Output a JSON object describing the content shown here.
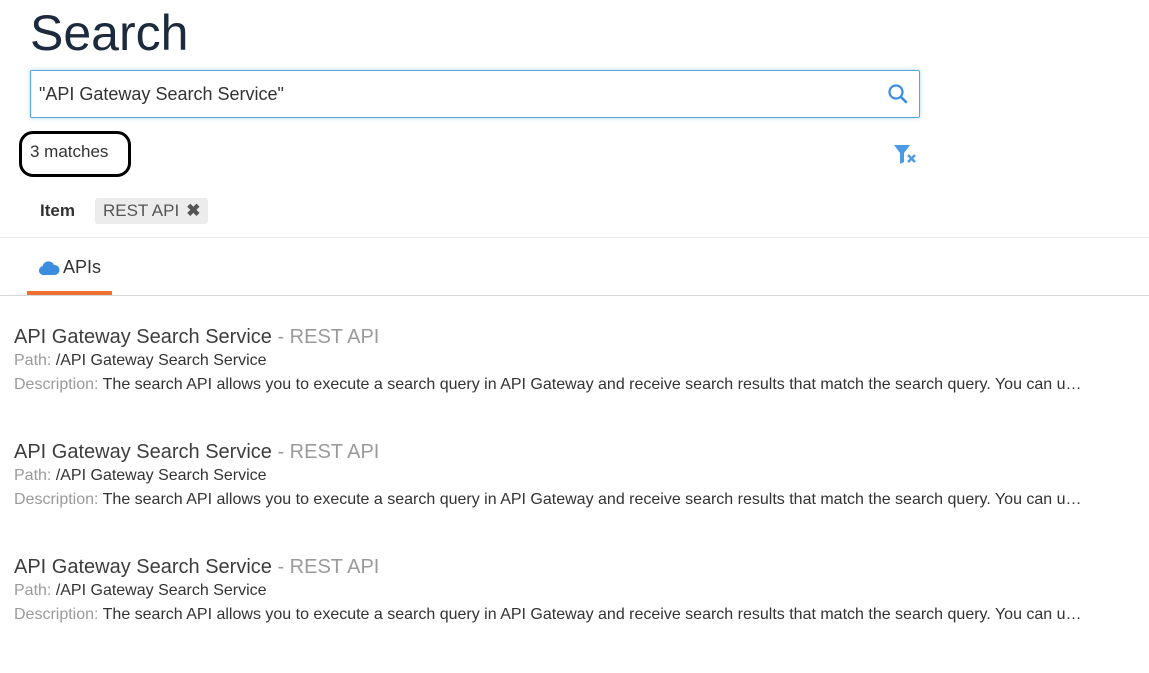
{
  "header": {
    "title": "Search"
  },
  "search": {
    "value": "\"API Gateway Search Service\"",
    "placeholder": ""
  },
  "summary": {
    "match_count": "3 matches"
  },
  "filters": {
    "facet_label": "Item",
    "chips": [
      {
        "label": "REST API",
        "remove_glyph": "✖"
      }
    ]
  },
  "tabs": [
    {
      "label": "APIs",
      "icon": "cloud-icon",
      "active": true
    }
  ],
  "colors": {
    "accent": "#f0712d",
    "link_icon": "#3b8de0",
    "title": "#1b2a3c",
    "annotation": "#000000"
  },
  "results": [
    {
      "name": "API Gateway Search Service",
      "type": "- REST API",
      "path_label": "Path:",
      "path": "/API Gateway Search Service",
      "description_label": "Description:",
      "description": "The search API allows you to execute a search query in API Gateway and receive search results that match the search query. You can use this service to search for APIs, applications, aliases, policies and other API Gateway assets."
    },
    {
      "name": "API Gateway Search Service",
      "type": "- REST API",
      "path_label": "Path:",
      "path": "/API Gateway Search Service",
      "description_label": "Description:",
      "description": "The search API allows you to execute a search query in API Gateway and receive search results that match the search query. You can use this service to search for APIs, applications, aliases, policies and other API Gateway assets."
    },
    {
      "name": "API Gateway Search Service",
      "type": "- REST API",
      "path_label": "Path:",
      "path": "/API Gateway Search Service",
      "description_label": "Description:",
      "description": "The search API allows you to execute a search query in API Gateway and receive search results that match the search query. You can use this service to search for APIs, applications, aliases, policies and other API Gateway assets."
    }
  ]
}
